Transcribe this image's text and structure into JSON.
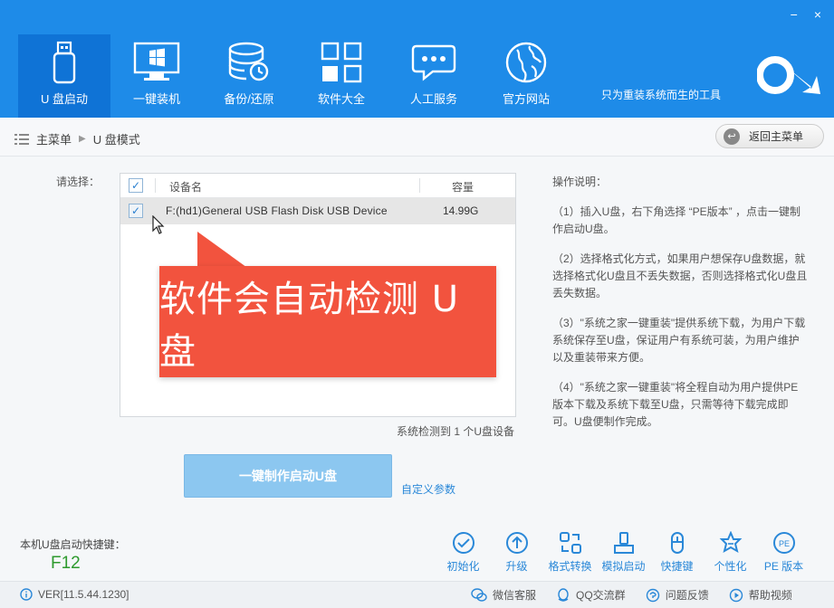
{
  "window": {
    "minimize": "−",
    "close": "×"
  },
  "nav": [
    {
      "label": "U 盘启动",
      "icon": "usb-drive-icon",
      "active": true
    },
    {
      "label": "一键装机",
      "icon": "windows-monitor-icon"
    },
    {
      "label": "备份/还原",
      "icon": "database-backup-icon"
    },
    {
      "label": "软件大全",
      "icon": "apps-grid-icon"
    },
    {
      "label": "人工服务",
      "icon": "chat-bubble-icon"
    },
    {
      "label": "官方网站",
      "icon": "globe-icon"
    }
  ],
  "slogan": "只为重装系统而生的工具",
  "breadcrumb": {
    "root": "主菜单",
    "current": "U 盘模式"
  },
  "back_button": "返回主菜单",
  "choose_label": "请选择：",
  "table": {
    "headers": {
      "name": "设备名",
      "capacity": "容量"
    },
    "rows": [
      {
        "name": "F:(hd1)General USB Flash Disk USB Device",
        "capacity": "14.99G"
      }
    ]
  },
  "callout": "软件会自动检测 U 盘",
  "detect_info": "系统检测到 1 个U盘设备",
  "instructions": {
    "title": "操作说明：",
    "items": [
      "（1）插入U盘，右下角选择 “PE版本” ，点击一键制作启动U盘。",
      "（2）选择格式化方式，如果用户想保存U盘数据，就选择格式化U盘且不丢失数据，否则选择格式化U盘且丢失数据。",
      "（3）\"系统之家一键重装\"提供系统下载，为用户下载系统保存至U盘，保证用户有系统可装，为用户维护以及重装带来方便。",
      "（4）\"系统之家一键重装\"将全程自动为用户提供PE版本下载及系统下载至U盘，只需等待下载完成即可。U盘便制作完成。"
    ]
  },
  "make_button": "一键制作启动U盘",
  "custom_params": "自定义参数",
  "hotkey": {
    "label": "本机U盘启动快捷键：",
    "value": "F12"
  },
  "tools": [
    {
      "label": "初始化",
      "icon": "check-circle-icon"
    },
    {
      "label": "升级",
      "icon": "upgrade-arrow-icon"
    },
    {
      "label": "格式转换",
      "icon": "format-convert-icon"
    },
    {
      "label": "模拟启动",
      "icon": "simulate-boot-icon"
    },
    {
      "label": "快捷键",
      "icon": "mouse-icon"
    },
    {
      "label": "个性化",
      "icon": "personalize-icon"
    },
    {
      "label": "PE 版本",
      "icon": "pe-badge-icon",
      "badge": "PE"
    }
  ],
  "status": {
    "version": "VER[11.5.44.1230]",
    "links": [
      {
        "label": "微信客服",
        "icon": "wechat-icon"
      },
      {
        "label": "QQ交流群",
        "icon": "qq-icon"
      },
      {
        "label": "问题反馈",
        "icon": "feedback-icon"
      },
      {
        "label": "帮助视频",
        "icon": "help-video-icon"
      }
    ]
  },
  "colors": {
    "topbar": "#1e8be8",
    "active_nav": "#0f73d6",
    "callout": "#f2533e",
    "link": "#2a88d8",
    "hotkey": "#2e9a2e"
  }
}
